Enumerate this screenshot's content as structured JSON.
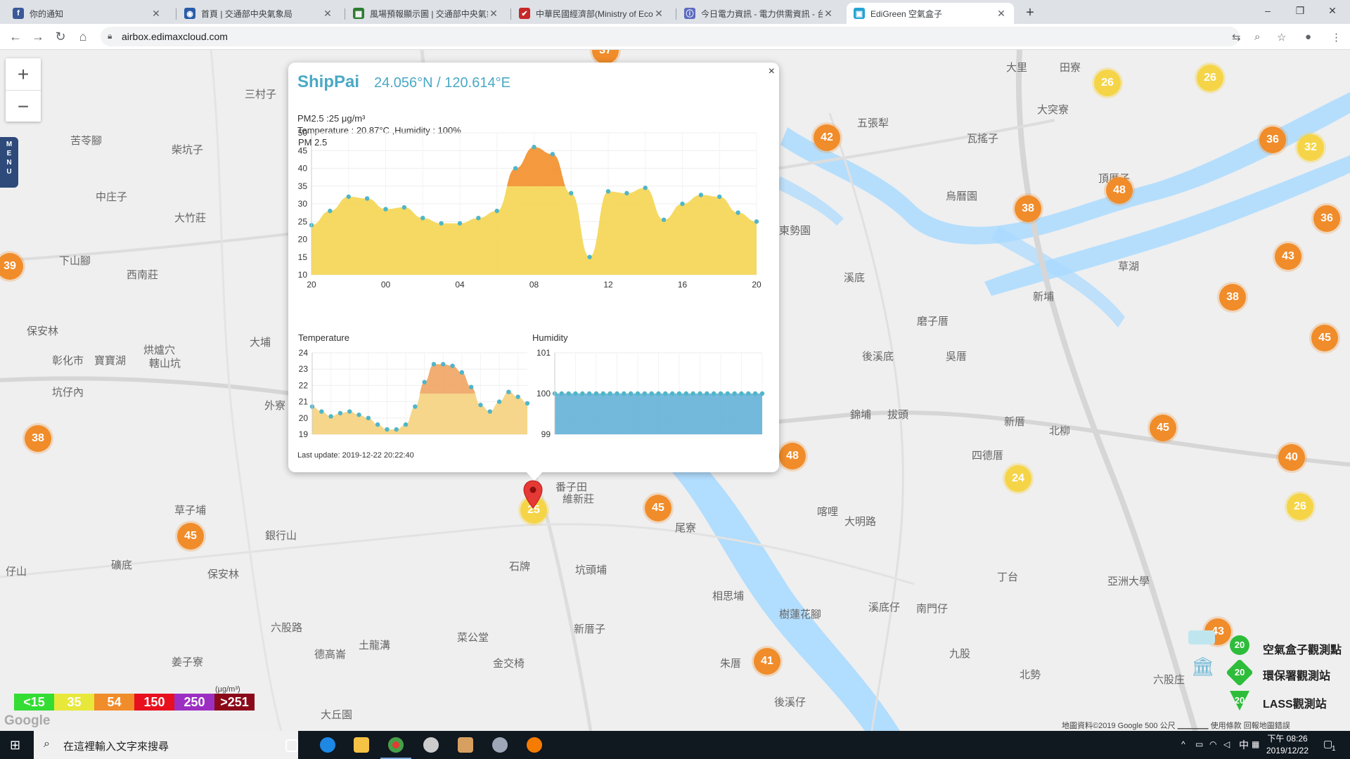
{
  "browser": {
    "tabs": [
      {
        "title": "你的通知",
        "favicon_color": "#3b5998",
        "favicon_glyph": "f"
      },
      {
        "title": "首頁 | 交通部中央氣象局",
        "favicon_color": "#2a5caa",
        "favicon_glyph": "◉"
      },
      {
        "title": "風場預報顯示圖 | 交通部中央氣象",
        "favicon_color": "#2e7d32",
        "favicon_glyph": "▦"
      },
      {
        "title": "中華民國經濟部(Ministry of Econ",
        "favicon_color": "#c62828",
        "favicon_glyph": "✔"
      },
      {
        "title": "今日電力資訊 - 電力供需資訊 - 台",
        "favicon_color": "#5c6bc0",
        "favicon_glyph": "ⓘ"
      },
      {
        "title": "EdiGreen 空氣盒子",
        "favicon_color": "#26a3d4",
        "favicon_glyph": "▣"
      }
    ],
    "active_tab": 5,
    "url": "airbox.edimaxcloud.com",
    "window_controls": [
      "–",
      "❐",
      "✕"
    ],
    "new_tab_glyph": "+"
  },
  "map": {
    "zoom_in": "+",
    "zoom_out": "−",
    "menu_label": "M\nE\nN\nU",
    "places": [
      "三村子",
      "五張犁",
      "瓦搖子",
      "大里",
      "田寮",
      "大突寮",
      "苦苓腳",
      "柴坑子",
      "中庄子",
      "大竹莊",
      "頂厝子",
      "烏曆園",
      "下山腳",
      "西南莊",
      "東勢園",
      "溪底",
      "新埔",
      "草湖",
      "磨子厝",
      "保安林",
      "彰化市",
      "寶寶湖",
      "烘爐穴",
      "轄山坑",
      "大埔",
      "後溪底",
      "吳厝",
      "坑仔內",
      "外寮",
      "錦埔",
      "拔頭",
      "新厝",
      "北柳",
      "四德厝",
      "喀哩",
      "大明路",
      "草子埔",
      "石牌",
      "番子田",
      "維新莊",
      "尾寮",
      "坑頭埔",
      "銀行山",
      "礦底",
      "保安林",
      "六股路",
      "土龍溝",
      "菜公堂",
      "新厝子",
      "相思埔",
      "樹蓮花腳",
      "溪底仔",
      "南門仔",
      "丁台",
      "德高崙",
      "金交椅",
      "九股",
      "北勢",
      "朱厝",
      "後溪仔",
      "姜子寮",
      "大丘園",
      "亞洲大學",
      "六股庄",
      "仔山"
    ],
    "markers": [
      {
        "v": "37",
        "c": "o"
      },
      {
        "v": "42",
        "c": "o"
      },
      {
        "v": "26",
        "c": "y"
      },
      {
        "v": "26",
        "c": "y"
      },
      {
        "v": "36",
        "c": "o"
      },
      {
        "v": "32",
        "c": "y"
      },
      {
        "v": "48",
        "c": "o"
      },
      {
        "v": "38",
        "c": "o"
      },
      {
        "v": "36",
        "c": "o"
      },
      {
        "v": "43",
        "c": "o"
      },
      {
        "v": "38",
        "c": "o"
      },
      {
        "v": "39",
        "c": "o"
      },
      {
        "v": "45",
        "c": "o"
      },
      {
        "v": "38",
        "c": "o"
      },
      {
        "v": "48",
        "c": "o"
      },
      {
        "v": "45",
        "c": "o"
      },
      {
        "v": "24",
        "c": "y"
      },
      {
        "v": "40",
        "c": "o"
      },
      {
        "v": "26",
        "c": "y"
      },
      {
        "v": "45",
        "c": "o"
      },
      {
        "v": "45",
        "c": "o"
      },
      {
        "v": "25",
        "c": "y"
      },
      {
        "v": "41",
        "c": "o"
      },
      {
        "v": "43",
        "c": "o"
      }
    ],
    "legend": [
      {
        "label": "<15",
        "color": "#33dd33"
      },
      {
        "label": "35",
        "color": "#e8e83a"
      },
      {
        "label": "54",
        "color": "#f08c2a"
      },
      {
        "label": "150",
        "color": "#e8101e"
      },
      {
        "label": "250",
        "color": "#9c2fc2"
      },
      {
        "label": ">251",
        "color": "#8b0a1a"
      }
    ],
    "legend_unit": "(μg/m³)",
    "google_logo": "Google",
    "station_legend": [
      {
        "label": "空氣盒子觀測點",
        "count": "20"
      },
      {
        "label": "環保署觀測站",
        "count": "20"
      },
      {
        "label": "LASS觀測站",
        "count": "20"
      }
    ],
    "attribution": "地圖資料©2019 Google   500 公尺 ▁▁▁▁   使用條款   回報地圖錯誤"
  },
  "popup": {
    "close": "×",
    "name": "ShipPai",
    "coords": "24.056°N / 120.614°E",
    "pm25_line": "PM2.5 :25 μg/m³",
    "env_line": "Temperature : 20.87°C ,Humidity : 100%",
    "last_update": "Last update: 2019-12-22 20:22:40"
  },
  "chart_data": [
    {
      "type": "area",
      "title": "PM 2.5",
      "x_ticks": [
        "20",
        "00",
        "04",
        "08",
        "12",
        "16",
        "20"
      ],
      "ylim": [
        10,
        50
      ],
      "y_ticks": [
        10,
        15,
        20,
        25,
        30,
        35,
        40,
        45,
        50
      ],
      "threshold": 35,
      "colors": {
        "below": "#f5d75a",
        "above": "#f39435",
        "point": "#4fb6c8"
      },
      "values": [
        24,
        28,
        32,
        31.5,
        28.5,
        29,
        26,
        24.5,
        24.5,
        26,
        28,
        40,
        46,
        44,
        33,
        15,
        33.5,
        33,
        34.5,
        25.5,
        30,
        32.5,
        32,
        27.5,
        25
      ]
    },
    {
      "type": "area",
      "title": "Temperature",
      "ylim": [
        19,
        24
      ],
      "y_ticks": [
        19,
        20,
        21,
        22,
        23,
        24
      ],
      "threshold": 21.5,
      "colors": {
        "below": "#f5d484",
        "above": "#f0a96a",
        "point": "#4fb6c8"
      },
      "values": [
        20.7,
        20.4,
        20.1,
        20.3,
        20.4,
        20.2,
        20.0,
        19.6,
        19.3,
        19.3,
        19.6,
        20.7,
        22.2,
        23.3,
        23.3,
        23.2,
        22.8,
        21.9,
        20.8,
        20.4,
        21.0,
        21.6,
        21.3,
        20.9
      ]
    },
    {
      "type": "area",
      "title": "Humidity",
      "ylim": [
        99,
        101
      ],
      "y_ticks": [
        99,
        100,
        101
      ],
      "colors": {
        "below": "#6bb5d9",
        "point": "#4fb6c8"
      },
      "values": [
        100,
        100,
        100,
        100,
        100,
        100,
        100,
        100,
        100,
        100,
        100,
        100,
        100,
        100,
        100,
        100,
        100,
        100,
        100,
        100,
        100,
        100,
        100,
        100,
        100,
        100,
        100,
        100,
        100,
        100,
        100
      ]
    }
  ],
  "taskbar": {
    "search_placeholder": "在這裡輸入文字來搜尋",
    "tray_ime": "中",
    "time": "下午 08:26",
    "date": "2019/12/22",
    "notification_count": "1"
  }
}
